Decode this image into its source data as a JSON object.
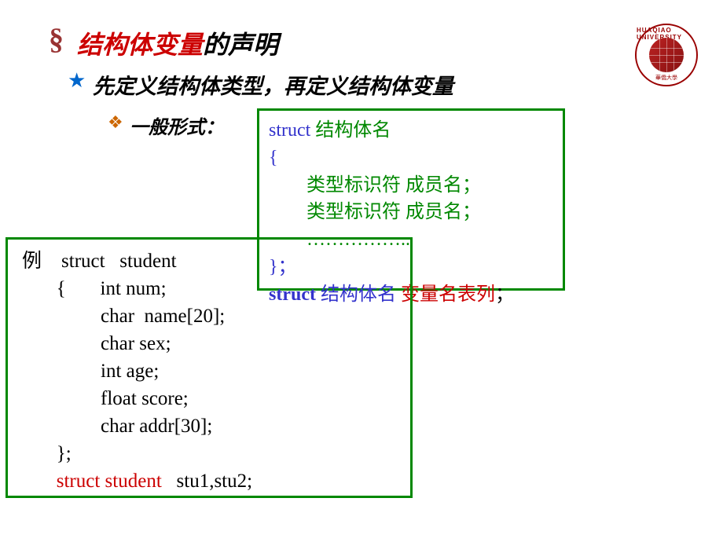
{
  "header": {
    "section_marker": "§",
    "title_red": "结构体变量",
    "title_black": "的声明"
  },
  "subtitle": {
    "star": "★",
    "text": "先定义结构体类型，再定义结构体变量"
  },
  "form": {
    "diamond": "❖",
    "label": "一般形式：",
    "colon": ""
  },
  "syntax": {
    "line1_a": "struct",
    "line1_b": "    结构体名",
    "line2": "{",
    "line3": "类型标识符    成员名；",
    "line4": "类型标识符    成员名；",
    "line5": " ……………..",
    "line6": "}；",
    "line7_a": "struct",
    "line7_b": "  结构体名",
    "line7_c": "  变量名表列",
    "line7_d": "；"
  },
  "example": {
    "line1_a": "例    ",
    "line1_b": "struct   student",
    "line2": "       {       int num;",
    "line3": "                char  name[20];",
    "line4": "                char sex;",
    "line5": "                int age;",
    "line6": "                float score;",
    "line7": "                char addr[30];",
    "line8": "       };",
    "line9_a": "       ",
    "line9_b": "struct student",
    "line9_c": "   stu1,stu2;"
  },
  "logo": {
    "top_text": "HUAQIAO UNIVERSITY",
    "bottom_text": "華僑大學"
  }
}
